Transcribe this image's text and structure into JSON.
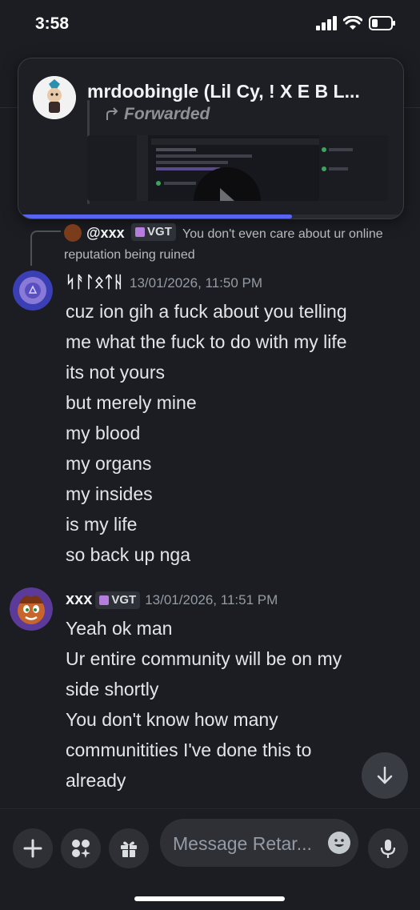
{
  "status": {
    "time": "3:58"
  },
  "forwarded": {
    "title": "mrdoobingle (Lil Cy, ! X E B L...",
    "label": "Forwarded",
    "progress_fraction": 0.71
  },
  "reply": {
    "user": "@xxx",
    "tag": "VGT",
    "text": "You don't even care about ur online reputation being ruined"
  },
  "messages": [
    {
      "user": "ᛋᚨᛚᛟᛏᚺ",
      "time": "13/01/2026, 11:50 PM",
      "lines": [
        "cuz ion gih a fuck about you telling",
        "me what the fuck to do with my life",
        "its not yours",
        "but merely mine",
        "my blood",
        "my organs",
        "my insides",
        "is my life",
        "so back up nga"
      ]
    },
    {
      "user": "xxx",
      "tag": "VGT",
      "time": "13/01/2026, 11:51 PM",
      "lines": [
        "Yeah ok man",
        "Ur entire community will be on my",
        "side shortly",
        "You don't know how many",
        "communitities I've done this to",
        "already"
      ]
    }
  ],
  "composer": {
    "placeholder": "Message Retar..."
  },
  "icons": {
    "plus": "plus-icon",
    "apps": "apps-icon",
    "gift": "gift-icon",
    "emoji": "emoji-icon",
    "mic": "microphone-icon",
    "scroll": "arrow-down-icon"
  }
}
